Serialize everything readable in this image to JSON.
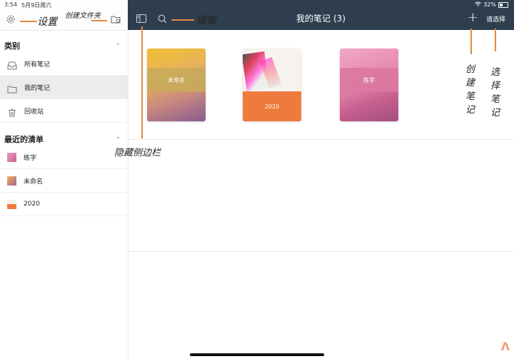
{
  "status": {
    "time": "3:54",
    "date": "5月9日周六",
    "battery": "32%"
  },
  "header": {
    "title": "我的笔记",
    "count": "(3)",
    "select_label": "请选择",
    "plus_label": "+"
  },
  "sidebar": {
    "categories_title": "类别",
    "categories": [
      {
        "label": "所有笔记"
      },
      {
        "label": "我的笔记"
      },
      {
        "label": "回收站"
      }
    ],
    "recent_title": "最近的清单",
    "recent": [
      {
        "label": "练字"
      },
      {
        "label": "未命名"
      },
      {
        "label": "2020"
      }
    ]
  },
  "notebooks": [
    {
      "label": "未命名"
    },
    {
      "label": "2020"
    },
    {
      "label": "练字"
    }
  ],
  "annotations": {
    "settings": "设置",
    "create_folder": "创建文件夹",
    "search": "搜索",
    "hide_sidebar": "隐藏侧边栏",
    "create_note": "创建笔记",
    "select_note": "选择笔记"
  },
  "colors": {
    "topbar": "#2e3e4e",
    "accent": "#e58a3a",
    "cover_orange": "#f07a3e",
    "cover_pink": "#d87aa0"
  }
}
